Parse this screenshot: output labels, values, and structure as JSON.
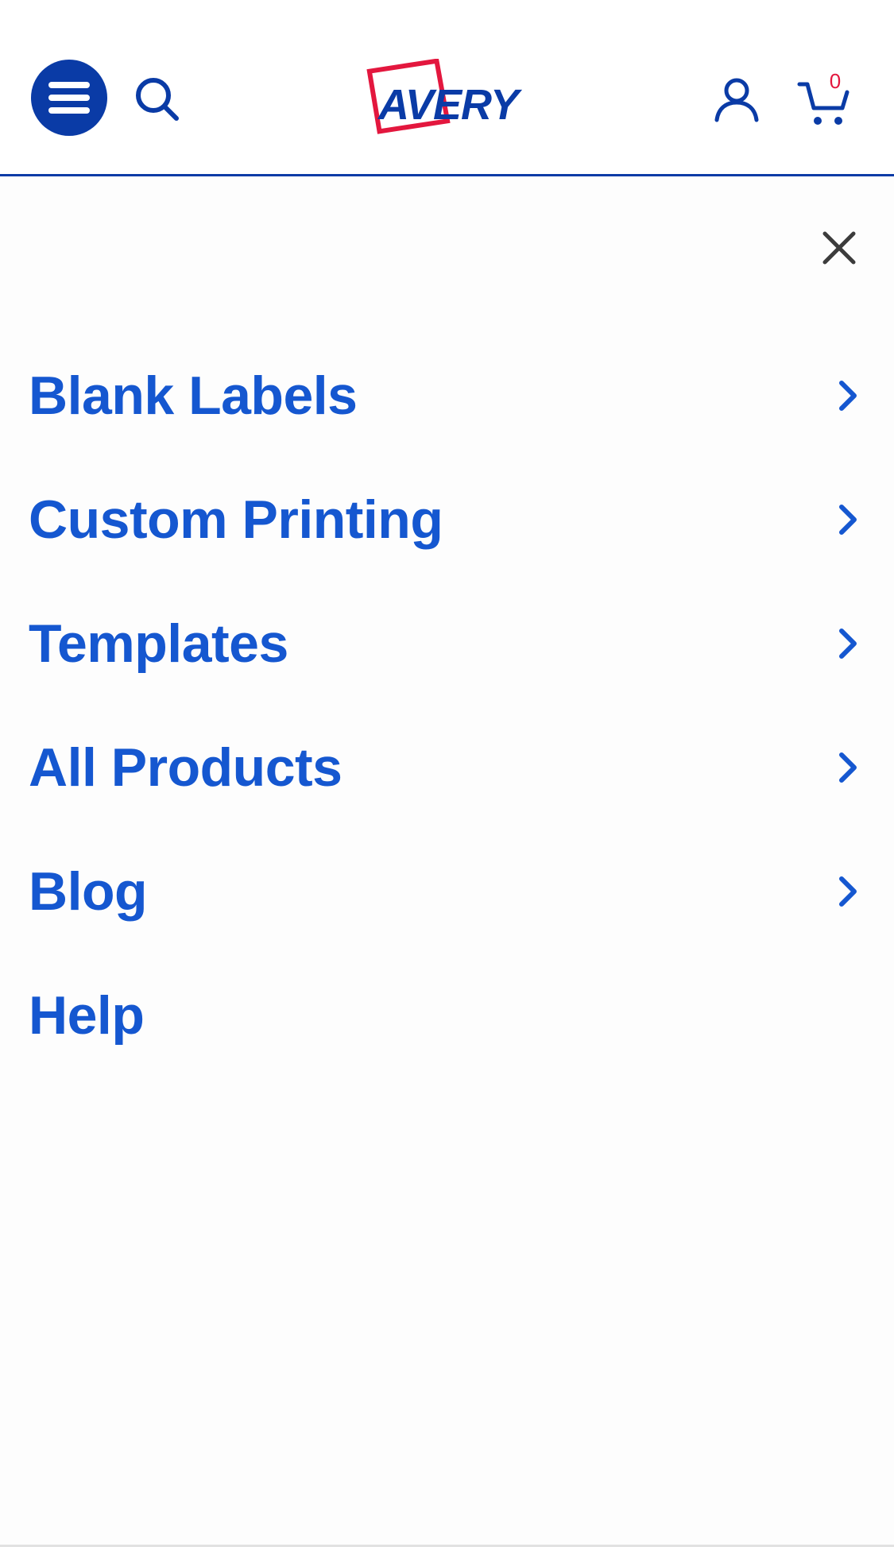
{
  "header": {
    "logo_text": "AVERY",
    "cart_count": "0"
  },
  "icons": {
    "menu": "hamburger-icon",
    "search": "search-icon",
    "account": "user-icon",
    "cart": "cart-icon",
    "close": "close-icon",
    "chevron": "chevron-right-icon"
  },
  "colors": {
    "brand_blue": "#0a3ba6",
    "link_blue": "#1557d0",
    "brand_red": "#e3173e",
    "close_gray": "#3c3c3c"
  },
  "menu": {
    "items": [
      {
        "label": "Blank Labels",
        "has_submenu": true
      },
      {
        "label": "Custom Printing",
        "has_submenu": true
      },
      {
        "label": "Templates",
        "has_submenu": true
      },
      {
        "label": "All Products",
        "has_submenu": true
      },
      {
        "label": "Blog",
        "has_submenu": true
      },
      {
        "label": "Help",
        "has_submenu": false
      }
    ]
  }
}
